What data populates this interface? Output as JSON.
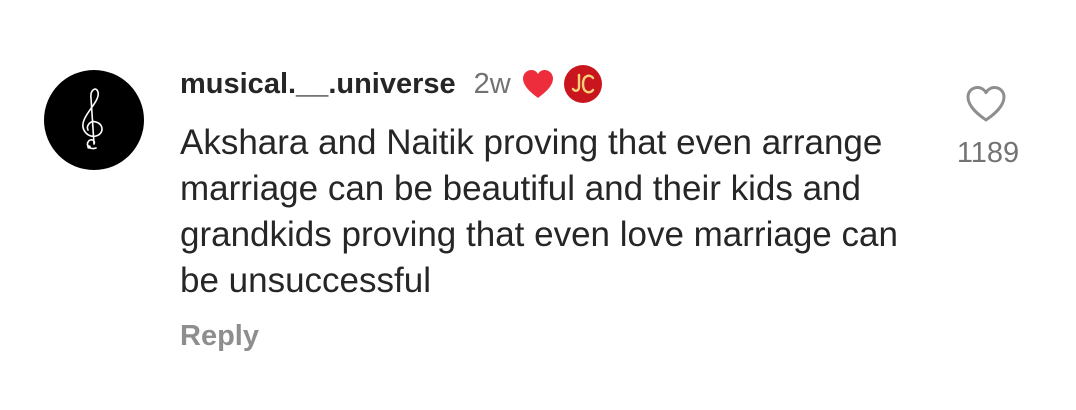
{
  "comment": {
    "author": {
      "username": "musical.__.universe",
      "avatar_icon": "treble-clef-icon",
      "avatar_bg": "#000000"
    },
    "time_ago": "2w",
    "liked_by_creator_icon": "heart-icon",
    "liked_by_creator_color": "#ed2c3c",
    "creator_badge": {
      "icon": "creator-monogram-icon",
      "bg_color": "#c9161e"
    },
    "text": "Akshara and Naitik proving that even arrange marriage can be beautiful and their kids and grandkids proving that even love marriage can be unsuccessful",
    "reply_label": "Reply",
    "like": {
      "icon": "heart-outline-icon",
      "count": "1189"
    }
  }
}
